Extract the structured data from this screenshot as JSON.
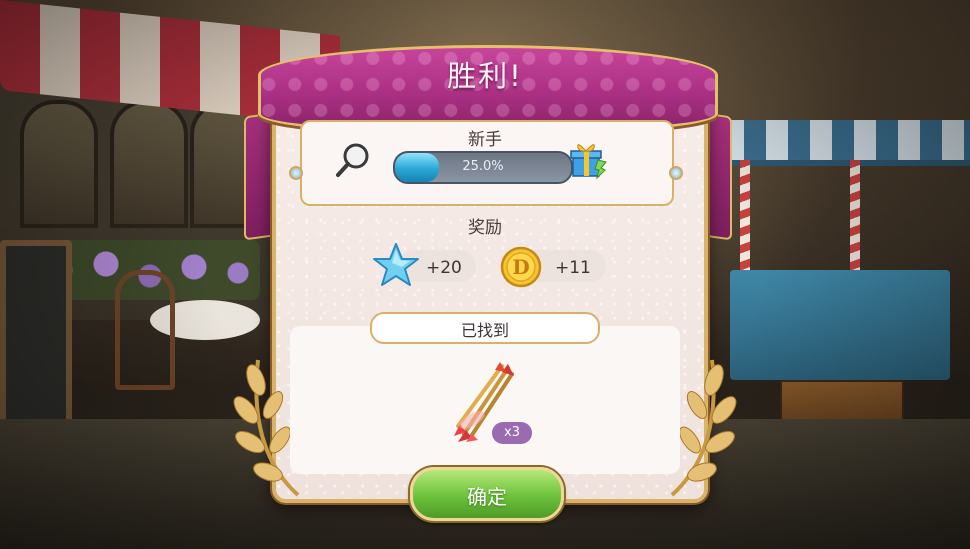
{
  "dialog": {
    "title": "胜利!",
    "level_label": "新手",
    "progress": {
      "text": "25.0%",
      "fraction": 0.25
    },
    "reward_label": "奖励",
    "rewards": [
      {
        "icon": "star-icon",
        "value": "+20"
      },
      {
        "icon": "coin-icon",
        "value": "+11"
      }
    ],
    "found_label": "已找到",
    "found_items": [
      {
        "icon": "arrows-icon",
        "quantity": "x3"
      }
    ],
    "confirm_button": "确定"
  },
  "colors": {
    "ribbon": "#a82f82",
    "progress_fill": "#2aa6d6",
    "confirm_button": "#6cc23b",
    "badge": "#9a6bb0",
    "frame_gold": "#d8b46a"
  }
}
